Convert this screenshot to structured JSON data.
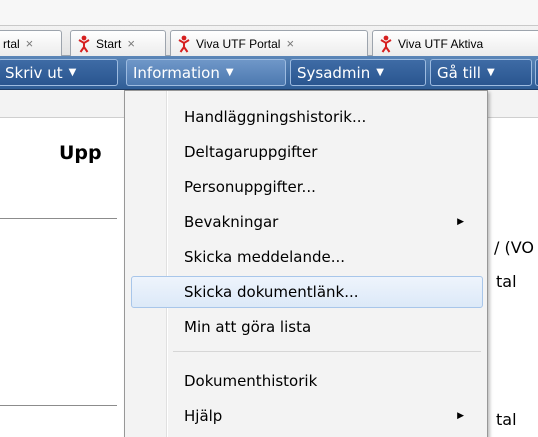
{
  "tabs": [
    {
      "label": "rtal",
      "close": "×"
    },
    {
      "label": "Start",
      "close": "×"
    },
    {
      "label": "Viva UTF Portal",
      "close": "×"
    },
    {
      "label": "Viva UTF Aktiva",
      "close": ""
    }
  ],
  "menubar": [
    {
      "label": "Skriv ut"
    },
    {
      "label": "Information"
    },
    {
      "label": "Sysadmin"
    },
    {
      "label": "Gå till"
    }
  ],
  "page": {
    "heading": "Upp",
    "text1": "/ (VO",
    "text2": "tal",
    "text3": "tal"
  },
  "dropdown": {
    "items": [
      {
        "label": "Handläggningshistorik...",
        "submenu": false
      },
      {
        "label": "Deltagaruppgifter",
        "submenu": false
      },
      {
        "label": "Personuppgifter...",
        "submenu": false
      },
      {
        "label": "Bevakningar",
        "submenu": true
      },
      {
        "label": "Skicka meddelande...",
        "submenu": false
      },
      {
        "label": "Skicka dokumentlänk...",
        "submenu": false,
        "highlighted": true
      },
      {
        "label": "Min att göra lista",
        "submenu": false
      },
      {
        "label": "Dokumenthistorik",
        "submenu": false
      },
      {
        "label": "Hjälp",
        "submenu": true
      }
    ]
  },
  "icons": {
    "tab_icon": "red-figure-icon",
    "caret": "caret-down-icon",
    "submenu_arrow": "submenu-arrow-icon"
  },
  "colors": {
    "menubar": "#2f5d96",
    "highlight": "#dce9f8",
    "tab_icon": "#d62020"
  }
}
